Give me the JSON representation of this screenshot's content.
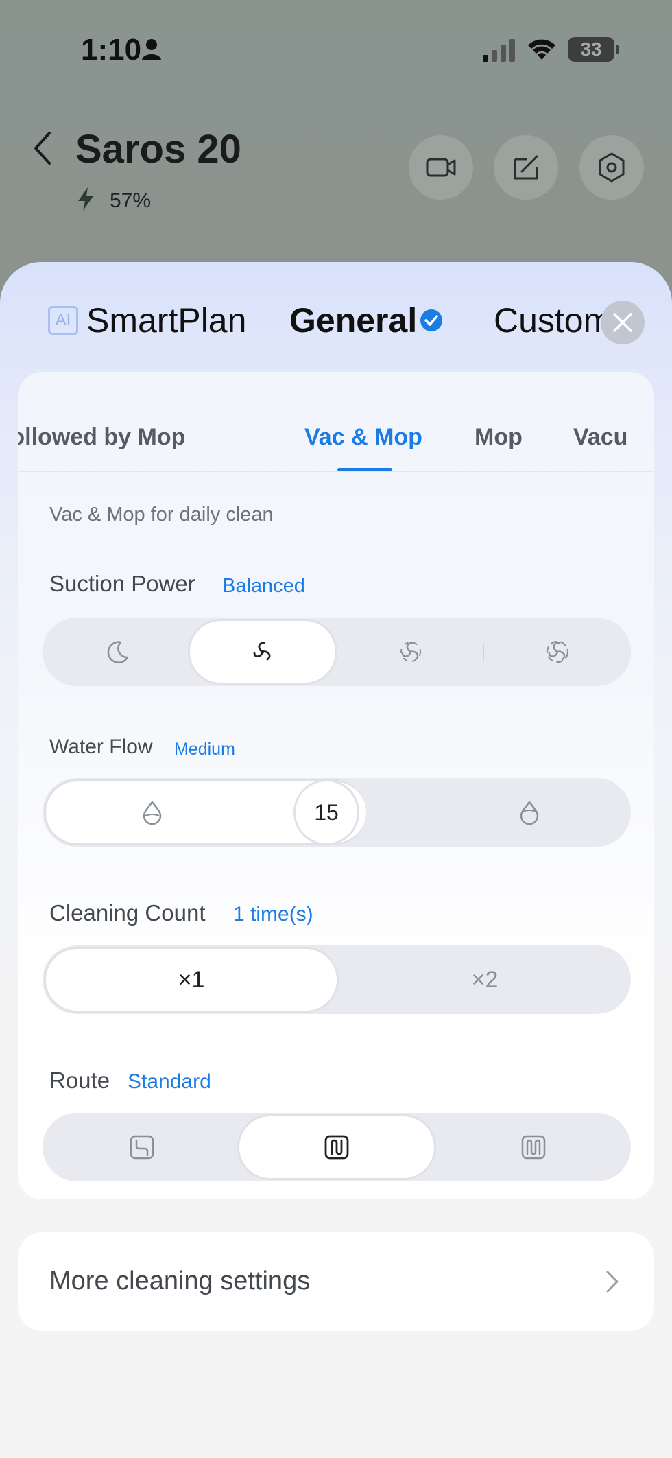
{
  "status_bar": {
    "time": "1:10",
    "battery": "33"
  },
  "header": {
    "title": "Saros 20",
    "battery_percent": "57%"
  },
  "mode_tabs": {
    "ai_badge": "AI",
    "smartplan": "SmartPlan",
    "general": "General",
    "custom": "Custom"
  },
  "sub_tabs": [
    "Vac followed by Mop",
    "Vac & Mop",
    "Mop",
    "Vacu"
  ],
  "description": "Vac & Mop for daily clean",
  "suction": {
    "label": "Suction Power",
    "value": "Balanced"
  },
  "water": {
    "label": "Water Flow",
    "value": "Medium",
    "level": "15"
  },
  "count": {
    "label": "Cleaning Count",
    "value": "1 time(s)",
    "options": [
      "×1",
      "×2"
    ]
  },
  "route": {
    "label": "Route",
    "value": "Standard"
  },
  "more": {
    "label": "More cleaning settings"
  },
  "colors": {
    "accent": "#1b7ce4",
    "sheet_top": "#d9e2fb"
  }
}
